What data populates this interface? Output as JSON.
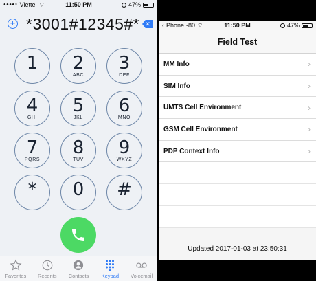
{
  "dialer": {
    "status": {
      "carrier": "Viettel",
      "time": "11:50 PM",
      "battery": "47%"
    },
    "number": "*3001#12345#*",
    "keys": [
      {
        "digit": "1",
        "letters": ""
      },
      {
        "digit": "2",
        "letters": "ABC"
      },
      {
        "digit": "3",
        "letters": "DEF"
      },
      {
        "digit": "4",
        "letters": "GHI"
      },
      {
        "digit": "5",
        "letters": "JKL"
      },
      {
        "digit": "6",
        "letters": "MNO"
      },
      {
        "digit": "7",
        "letters": "PQRS"
      },
      {
        "digit": "8",
        "letters": "TUV"
      },
      {
        "digit": "9",
        "letters": "WXYZ"
      },
      {
        "digit": "*",
        "letters": ""
      },
      {
        "digit": "0",
        "letters": "+"
      },
      {
        "digit": "#",
        "letters": ""
      }
    ],
    "tabs": [
      "Favorites",
      "Recents",
      "Contacts",
      "Keypad",
      "Voicemail"
    ],
    "active_tab": "Keypad",
    "colors": {
      "accent": "#2f7bf6",
      "call": "#4cd964"
    }
  },
  "fieldtest": {
    "status": {
      "back_app": "Phone",
      "signal": "-80",
      "time": "11:50 PM",
      "battery": "47%"
    },
    "title": "Field Test",
    "items": [
      "MM Info",
      "SIM Info",
      "UMTS Cell Environment",
      "GSM Cell Environment",
      "PDP Context Info"
    ],
    "chevron": "›",
    "footer": "Updated 2017-01-03 at 23:50:31"
  }
}
